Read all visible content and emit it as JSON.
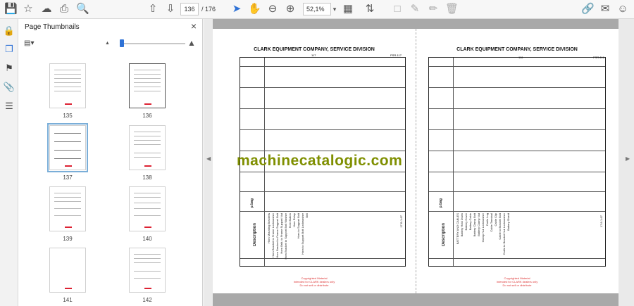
{
  "toolbar": {
    "current_page": "136",
    "separator": "/",
    "total_pages": "176",
    "zoom": "52,1%",
    "icons": [
      "save-icon",
      "bookmark-star-icon",
      "cloud-upload-icon",
      "print-icon",
      "zoom-search-icon",
      "page-up-icon",
      "page-down-icon",
      "select-cursor-icon",
      "hand-tool-icon",
      "zoom-out-icon",
      "zoom-in-icon",
      "zoom-dropdown-icon",
      "fit-page-icon",
      "scroll-mode-icon",
      "comment-icon",
      "pen-icon",
      "highlight-icon",
      "delete-icon",
      "share-link-icon",
      "email-icon",
      "account-icon"
    ]
  },
  "left_rail": {
    "icons": [
      "lock-icon",
      "thumbnails-icon",
      "bookmark-icon",
      "attachment-icon",
      "layers-icon"
    ]
  },
  "thumb_panel": {
    "title": "Page Thumbnails",
    "thumbnails": [
      {
        "label": "135"
      },
      {
        "label": "136"
      },
      {
        "label": "137"
      },
      {
        "label": "138"
      },
      {
        "label": "139"
      },
      {
        "label": "140"
      },
      {
        "label": "141"
      },
      {
        "label": "142"
      }
    ]
  },
  "document": {
    "left_header": "CLARK EQUIPMENT COMPANY, SERVICE DIVISION",
    "right_header": "CLARK EQUIPMENT COMPANY, SERVICE DIVISION",
    "left_page_no": "117",
    "right_page_no": "116",
    "left_code": "PSR-117",
    "right_code": "PSR-116",
    "watermark": "machinecatalogic.com",
    "footnote_line1": "Copyrighted Material",
    "footnote_line2": "Intended for CLARK dealers only",
    "footnote_line3": "Do not sell or distribute",
    "left_desc_title": "Description",
    "right_desc_title": "Description",
    "left_col_title": "p.bag",
    "right_col_title": "p.bag",
    "left_side_code": "17 B-1-67",
    "right_side_code": "17 8-1-67",
    "left_descriptions": [
      "Horn Mounting Brackets",
      "Horn Bracket to Frame Lockwasher",
      "Horn Bracket to Frame Support Bolt",
      "Horn Brkt. to Frame Support Nut",
      "Horn Bracket to Support Bolt Washer",
      "Horn Button",
      "Horn Relay",
      "Horn to Support Bolt",
      "Horn to Support Bolt Lockwasher",
      "Bell"
    ],
    "right_descriptions": [
      "BATTERY AND CABLES",
      "Battery Hold Down",
      "Battery Cover",
      "Battery Cable",
      "Battery Clamp Bolt",
      "Battery Clamp Nut",
      "Clamp Nut Lockwasher",
      "Cable Lug",
      "Cable Terminal",
      "Cable Clip",
      "Cable to Bracket Bolt",
      "Cable to Bracket Nut Lockwasher",
      "Battery Shield"
    ]
  }
}
